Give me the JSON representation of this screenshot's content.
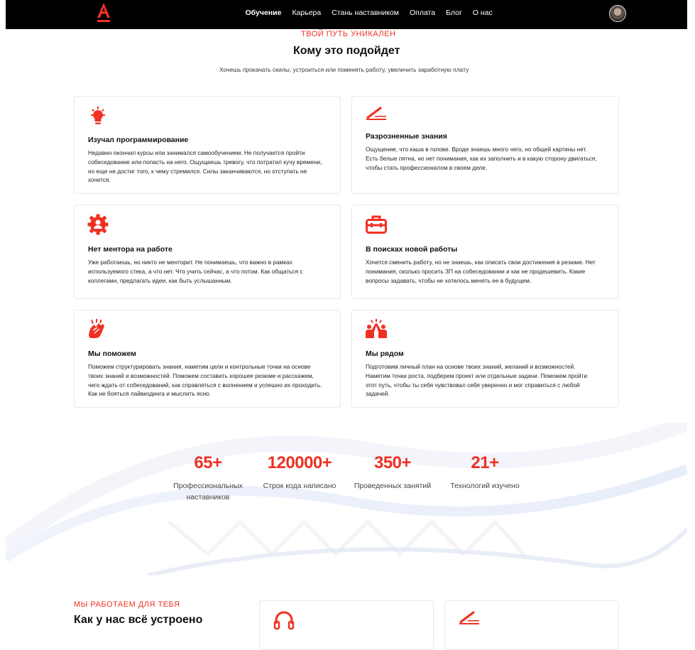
{
  "header": {
    "logo_alt": "А",
    "nav": [
      "Обучение",
      "Карьера",
      "Стань наставником",
      "Оплата",
      "Блог",
      "О нас"
    ],
    "active_nav": "Обучение"
  },
  "audience": {
    "eyebrow": "ТВОЙ ПУТЬ УНИКАЛЕН",
    "title": "Кому это подойдет",
    "subtitle": "Хочешь прокачать скилы, устроиться или поменять работу, увеличить заработную плату",
    "cards": [
      {
        "icon": "lightbulb-icon",
        "title": "Изучал программирование",
        "text": "Недавно окончил курсы или занимался самообучением. Не получается пройти собеседование или попасть на него. Ощущаешь тревогу, что потратил кучу времени, но еще не достиг того, к чему стремился. Силы заканчиваются, но отступать не хочется."
      },
      {
        "icon": "pencil-icon",
        "title": "Разрозненные знания",
        "text": "Ощущение, что каша в голове. Вроде знаешь много чего, но общей картины нет. Есть белые пятна, но нет понимания, как их заполнить и в какую сторону двигаться, чтобы стать профессионалом в своем деле."
      },
      {
        "icon": "gear-person-icon",
        "title": "Нет ментора на работе",
        "text": "Уже работаешь, но никто не менторит. Не понимаешь, что важно в рамках используемого стека, а что нет. Что учить сейчас, а что потом. Как общаться с коллегами, предлагать идеи, как быть услышанным."
      },
      {
        "icon": "briefcase-icon",
        "title": "В поисках новой работы",
        "text": "Хочется сменить работу, но не знаешь, как описать свои достижения в резюме. Нет понимания, сколько просить ЗП на собеседовании и как не продешевить. Какие вопросы задавать, чтобы не хотелось менять ее в будущем."
      },
      {
        "icon": "snap-hand-icon",
        "title": "Мы поможем",
        "text": "Поможем структурировать знания, наметим цели и контрольные точки на основе твоих знаний и возможностей. Поможем составить хорошее резюме и расскажем, чего ждать от собеседований, как справляться с волнением и успешно их проходить. Как не бояться лайвкодинга и мыслить ясно."
      },
      {
        "icon": "high-five-icon",
        "title": "Мы рядом",
        "text": "Подготовим личный план на основе твоих знаний, желаний и возможностей. Наметим точки роста, подберем проект или отдельные задачи. Поможем пройти этот путь, чтобы ты себя чувствовал себя уверенно и мог справиться с любой задачей."
      }
    ]
  },
  "stats": [
    {
      "value": "65+",
      "label": "Профессиональных наставников"
    },
    {
      "value": "120000+",
      "label": "Строк кода написано"
    },
    {
      "value": "350+",
      "label": "Проведенных занятий"
    },
    {
      "value": "21+",
      "label": "Технологий изучено"
    }
  ],
  "how": {
    "eyebrow": "МЫ РАБОТАЕМ ДЛЯ ТЕБЯ",
    "title": "Как у нас всё устроено",
    "card_icons": [
      "headphones-icon",
      "pencil-icon"
    ]
  },
  "colors": {
    "accent": "#ef3124",
    "topbar": "#000000",
    "card_border": "#e8e8ea"
  }
}
